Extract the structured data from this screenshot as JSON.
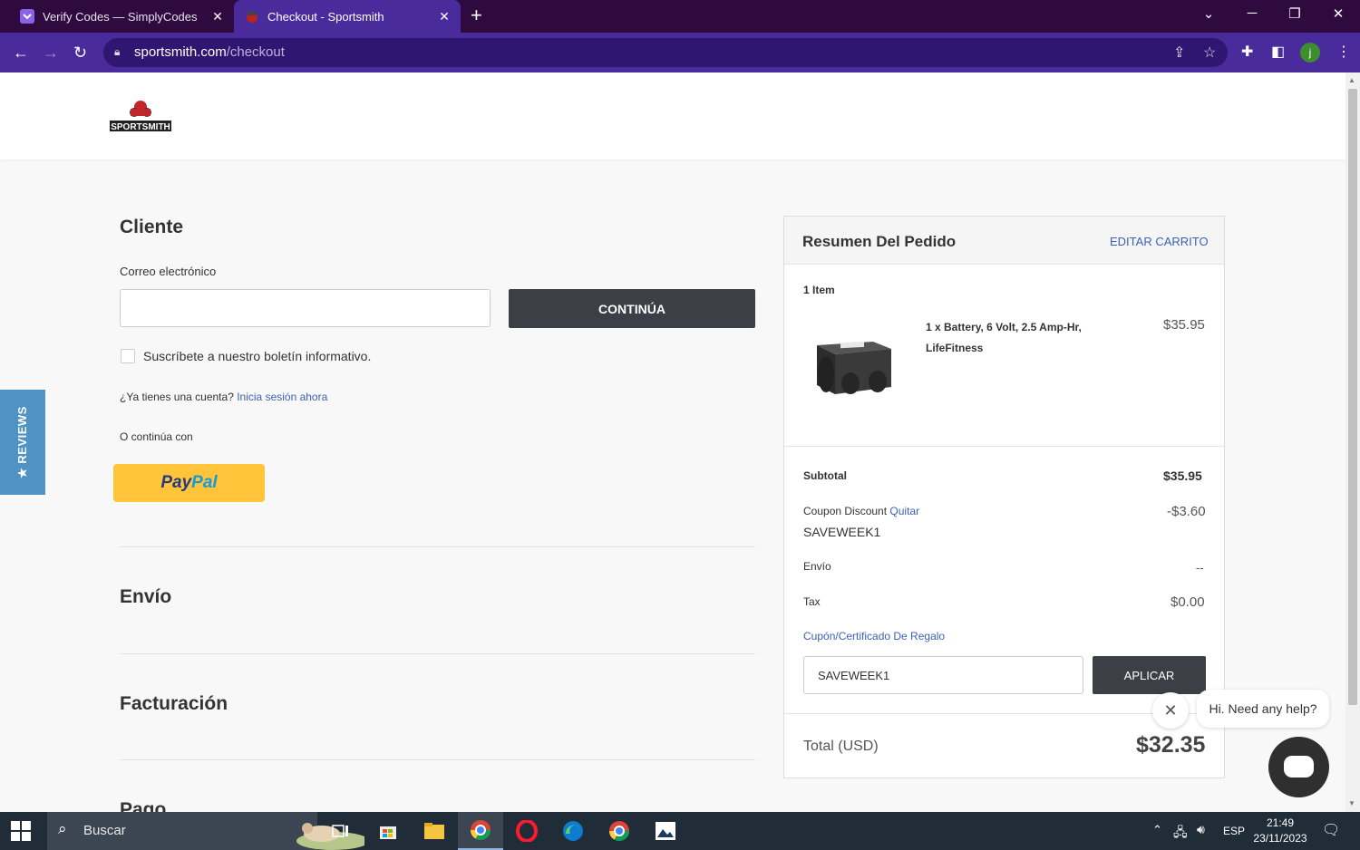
{
  "browser": {
    "tabs": [
      {
        "title": "Verify Codes — SimplyCodes",
        "active": false
      },
      {
        "title": "Checkout - Sportsmith",
        "active": true
      }
    ],
    "url_host": "sportsmith.com",
    "url_path": "/checkout",
    "profile_initial": "j"
  },
  "site": {
    "logo_text": "SPORTSMITH"
  },
  "checkout": {
    "customer_heading": "Cliente",
    "email_label": "Correo electrónico",
    "email_value": "",
    "continue_label": "CONTINÚA",
    "newsletter_label": "Suscríbete a nuestro boletín informativo.",
    "account_prompt": "¿Ya tienes una cuenta?",
    "signin_link": "Inicia sesión ahora",
    "or_continue": "O continúa con",
    "paypal_a": "Pay",
    "paypal_b": "Pal",
    "shipping_heading": "Envío",
    "billing_heading": "Facturación",
    "payment_heading": "Pago"
  },
  "reviews_tab": "★ REVIEWS",
  "summary": {
    "title": "Resumen Del Pedido",
    "edit_cart": "EDITAR CARRITO",
    "item_count": "1 Item",
    "item_line1": "1 x Battery, 6 Volt, 2.5 Amp-Hr,",
    "item_line2": "LifeFitness",
    "item_price": "$35.95",
    "subtotal_label": "Subtotal",
    "subtotal_value": "$35.95",
    "coupon_label": "Coupon Discount",
    "coupon_remove": "Quitar",
    "coupon_code": "SAVEWEEK1",
    "coupon_value": "-$3.60",
    "shipping_label": "Envío",
    "shipping_value": "--",
    "tax_label": "Tax",
    "tax_value": "$0.00",
    "gift_label": "Cupón/Certificado De Regalo",
    "coupon_input_value": "SAVEWEEK1",
    "apply_label": "APLICAR",
    "total_label": "Total (USD)",
    "total_value": "$32.35"
  },
  "chat": {
    "bubble_text": "Hi. Need any help?"
  },
  "taskbar": {
    "search_placeholder": "Buscar",
    "language": "ESP",
    "time": "21:49",
    "date": "23/11/2023"
  }
}
